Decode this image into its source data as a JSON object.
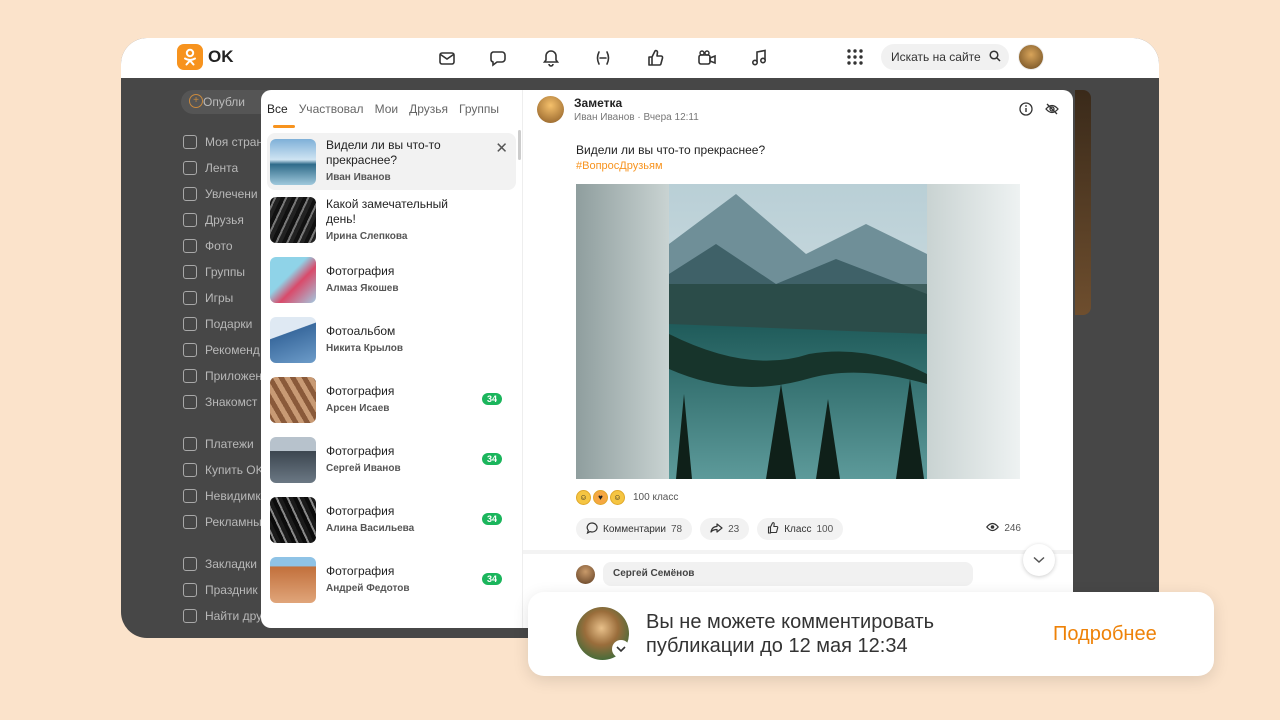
{
  "header": {
    "logo_text": "OK",
    "search_placeholder": "Искать на сайте",
    "nav_icons": [
      "mail-icon",
      "discussions-icon",
      "notifications-icon",
      "guests-icon",
      "likes-icon",
      "video-icon",
      "music-icon"
    ]
  },
  "leftnav": {
    "publish": "Опубли",
    "items": [
      "Моя стран",
      "Лента",
      "Увлечени",
      "Друзья",
      "Фото",
      "Группы",
      "Игры",
      "Подарки",
      "Рекоменд",
      "Приложен",
      "Знакомст",
      "Платежи",
      "Купить OK",
      "Невидимк",
      "Рекламны",
      "Закладки",
      "Праздник",
      "Найти дру"
    ]
  },
  "tabs": [
    "Все",
    "Участвовал",
    "Мои",
    "Друзья",
    "Группы"
  ],
  "list": [
    {
      "title": "Видели ли вы что-то прекраснее?",
      "author": "Иван Иванов",
      "badge": "",
      "thumb": "linear-gradient(#7eb0d8 0%,#cfe4f2 45%,#2f6b8a 55%,#9fc8dc 100%)"
    },
    {
      "title": "Какой замечательный день!",
      "author": "Ирина Слепкова",
      "badge": "",
      "thumb": "repeating-linear-gradient(115deg,#111 0 4px,#777 4px 6px,#222 6px 10px)"
    },
    {
      "title": "Фотография",
      "author": "Алмаз Якошев",
      "badge": "",
      "thumb": "linear-gradient(135deg,#8fd3e8 0%,#8fd3e8 40%,#d94a6a 60%,#a3c9e0 100%)"
    },
    {
      "title": "Фотоальбом",
      "author": "Никита Крылов",
      "badge": "",
      "thumb": "linear-gradient(160deg,#dfe9f3 0%,#dfe9f3 35%,#3a6a9e 36%,#6d9cc9 100%)"
    },
    {
      "title": "Фотография",
      "author": "Арсен Исаев",
      "badge": "34",
      "thumb": "repeating-linear-gradient(60deg,#8a5a3a 0 5px,#c89a74 5px 10px)"
    },
    {
      "title": "Фотография",
      "author": "Сергей Иванов",
      "badge": "34",
      "thumb": "linear-gradient(#b7c2cc 0%,#b7c2cc 30%,#3c4650 31%,#6b7884 100%)"
    },
    {
      "title": "Фотография",
      "author": "Алина Васильева",
      "badge": "34",
      "thumb": "repeating-linear-gradient(65deg,#0b0b0b 0 4px,#888 4px 6px,#1a1a1a 6px 10px)"
    },
    {
      "title": "Фотография",
      "author": "Андрей Федотов",
      "badge": "34",
      "thumb": "linear-gradient(#8fc3e6 0%,#8fc3e6 20%,#c2703c 21%,#e0a57a 100%)"
    }
  ],
  "post": {
    "type": "Заметка",
    "author": "Иван Иванов",
    "time": "Вчера 12:11",
    "text": "Видели ли вы что-то прекраснее?",
    "hashtag": "#ВопросДрузьям",
    "reactions_count": "100 класс",
    "comments_label": "Комментарии",
    "comments_count": "78",
    "shares_count": "23",
    "likes_label": "Класс",
    "likes_count": "100",
    "views": "246",
    "commenter": "Сергей Семёнов"
  },
  "toast": {
    "text": "Вы не можете комментировать публикации до 12 мая 12:34",
    "link": "Подробнее"
  },
  "colors": {
    "accent": "#f7931e",
    "badge": "#1bb55c",
    "link": "#ee8208",
    "background": "#fbe3cb"
  }
}
